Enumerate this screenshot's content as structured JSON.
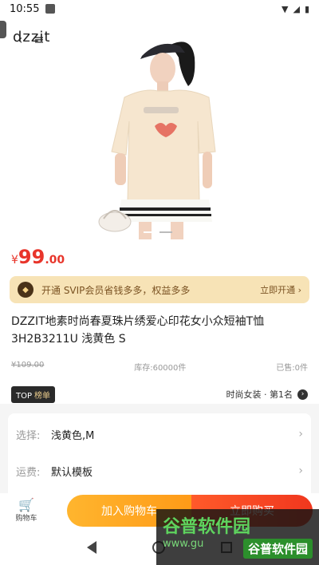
{
  "status": {
    "time": "10:55"
  },
  "header": {
    "brand": "dzzit",
    "back_icon": "back-arrow-icon",
    "menu_icon": "menu-icon"
  },
  "product": {
    "currency": "¥",
    "price_int": "99",
    "price_dec": ".00",
    "svip": {
      "text": "开通 SVIP会员省钱多多，权益多多",
      "cta": "立即开通 ›"
    },
    "title_line1": "DZZIT地素时尚春夏珠片绣爱心印花女小众短袖T恤",
    "title_line2": "3H2B3211U 浅黄色 S",
    "original_price": "¥109.00",
    "stock": "库存:60000件",
    "sold": "已售:0件",
    "rank": {
      "top": "TOP",
      "label": "榜单",
      "category": "时尚女装 · 第1名"
    }
  },
  "options": [
    {
      "key": "选择:",
      "value": "浅黄色,M"
    },
    {
      "key": "运费:",
      "value": "默认模板"
    }
  ],
  "bottom": {
    "cart_label": "购物车",
    "add_to_cart": "加入购物车",
    "buy_now": "立即购买"
  },
  "watermark": {
    "title": "谷普软件园",
    "url": "www.gu",
    "tag": "谷普软件园"
  }
}
